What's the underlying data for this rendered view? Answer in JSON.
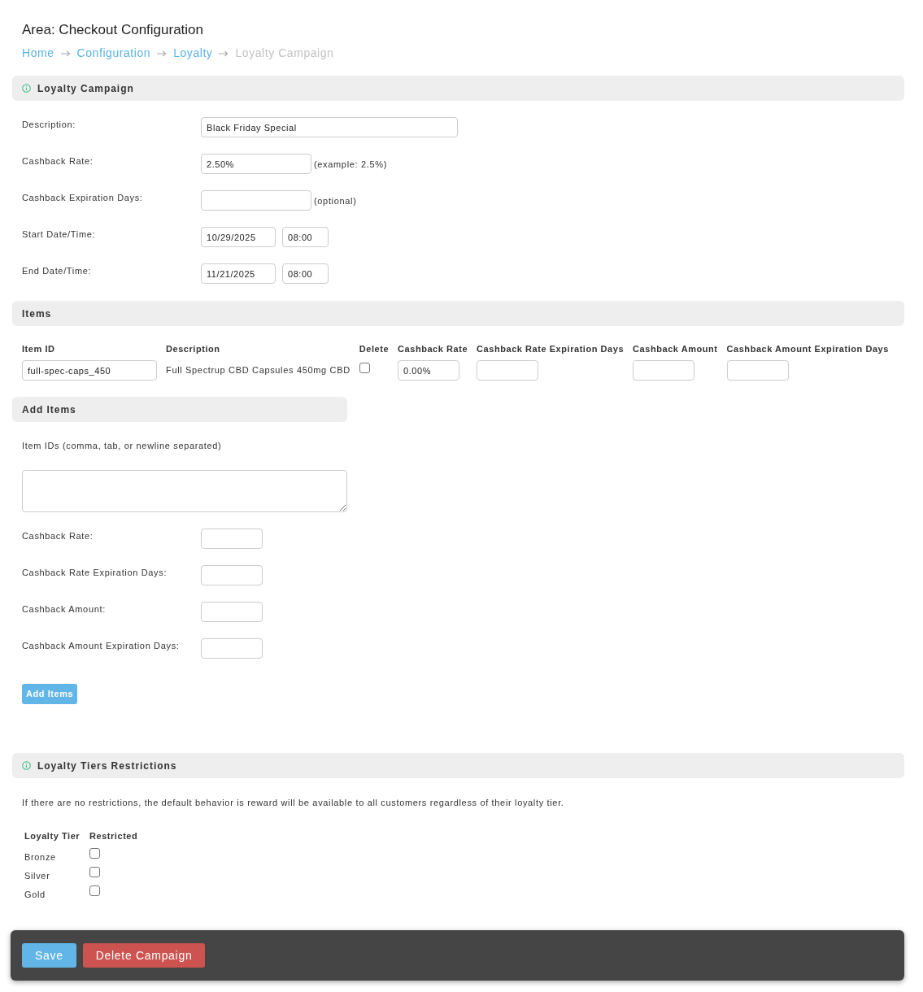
{
  "page": {
    "title": "Area: Checkout Configuration"
  },
  "breadcrumbs": [
    {
      "label": "Home",
      "kind": "link"
    },
    {
      "label": "Configuration",
      "kind": "link"
    },
    {
      "label": "Loyalty",
      "kind": "link"
    },
    {
      "label": "Loyalty Campaign",
      "kind": "current"
    }
  ],
  "campaign": {
    "title": "Loyalty Campaign",
    "info_icon": true,
    "fields": [
      {
        "label": "Description:",
        "kind": "wide",
        "value": "Black Friday Special"
      },
      {
        "label": "Cashback Rate:",
        "kind": "short",
        "value": "2.50%",
        "note": "(example: 2.5%)"
      },
      {
        "label": "Cashback Expiration Days:",
        "kind": "short",
        "note": "(optional)"
      },
      {
        "label": "Start Date/Time:",
        "kind": "datetime",
        "date": "10/29/2025",
        "time": "08:00"
      },
      {
        "label": "End Date/Time:",
        "kind": "datetime",
        "date": "11/21/2025",
        "time": "08:00"
      }
    ]
  },
  "items": {
    "title": "Items",
    "info_icon": false,
    "columns": [
      "Item ID",
      "Description",
      "Delete",
      "Cashback Rate",
      "Cashback Rate Expiration Days",
      "Cashback Amount",
      "Cashback Amount Expiration Days"
    ],
    "rows": [
      {
        "cells": [
          {
            "kind": "input",
            "value": "full-spec-caps_450"
          },
          {
            "kind": "text",
            "text": "Full Spectrup CBD Capsules 450mg CBD"
          },
          {
            "kind": "checkbox",
            "checked": false
          },
          {
            "kind": "input",
            "value": "0.00%"
          },
          {
            "kind": "input"
          },
          {
            "kind": "input"
          },
          {
            "kind": "input"
          }
        ]
      }
    ]
  },
  "add_items": {
    "title": "Add Items",
    "info_icon": false,
    "ids_label": "Item IDs (comma, tab, or newline separated)",
    "fields": [
      {
        "label": "Cashback Rate:"
      },
      {
        "label": "Cashback Rate Expiration Days:"
      },
      {
        "label": "Cashback Amount:"
      },
      {
        "label": "Cashback Amount Expiration Days:"
      }
    ],
    "button": "Add Items"
  },
  "tiers": {
    "title": "Loyalty Tiers Restrictions",
    "info_icon": true,
    "note": "If there are no restrictions, the default behavior is reward will be available to all customers regardless of their loyalty tier.",
    "columns": [
      "Loyalty Tier",
      "Restricted"
    ],
    "rows": [
      {
        "tier": "Bronze",
        "restricted": false
      },
      {
        "tier": "Silver",
        "restricted": false
      },
      {
        "tier": "Gold",
        "restricted": false
      }
    ]
  },
  "actions": [
    {
      "label": "Save",
      "kind": "primary"
    },
    {
      "label": "Delete Campaign",
      "kind": "danger"
    }
  ]
}
